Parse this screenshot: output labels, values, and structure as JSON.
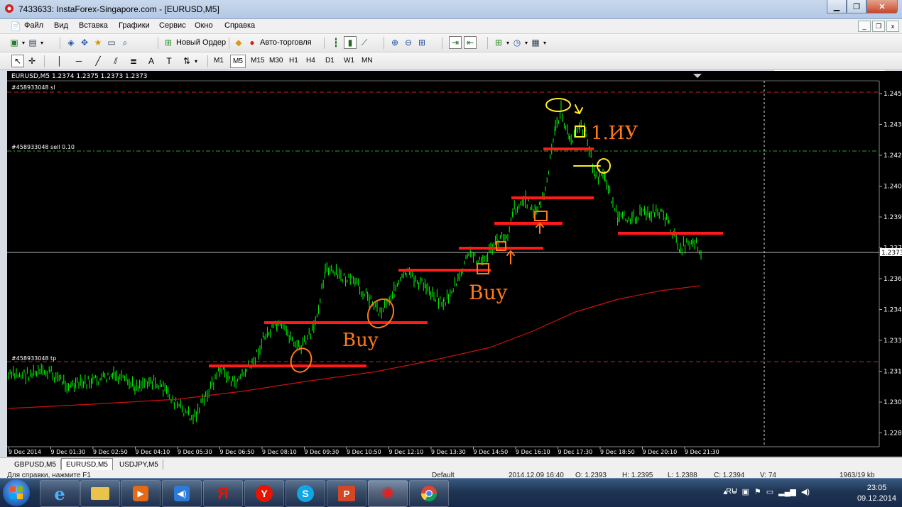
{
  "window": {
    "title": "7433633: InstaForex-Singapore.com - [EURUSD,M5]"
  },
  "menu": [
    "Файл",
    "Вид",
    "Вставка",
    "Графики",
    "Сервис",
    "Окно",
    "Справка"
  ],
  "toolbar": {
    "new_order": "Новый Ордер",
    "auto_trading": "Авто-торговля"
  },
  "timeframes": [
    "M1",
    "M5",
    "M15",
    "M30",
    "H1",
    "H4",
    "D1",
    "W1",
    "MN"
  ],
  "active_timeframe": "M5",
  "chart": {
    "header": "EURUSD,M5  1.2374 1.2375 1.2373 1.2373",
    "sl_label": "#458933048 sl",
    "sell_label": "#458933048 sell 0.10",
    "tp_label": "#458933048 tp",
    "current_price": "1.2373",
    "price_ticks": [
      "1.2450",
      "1.2435",
      "1.2420",
      "1.2405",
      "1.2390",
      "1.2375",
      "1.2360",
      "1.2345",
      "1.2330",
      "1.2315",
      "1.2300",
      "1.2285"
    ],
    "time_ticks": [
      "9 Dec 2014",
      "9 Dec 01:30",
      "9 Dec 02:50",
      "9 Dec 04:10",
      "9 Dec 05:30",
      "9 Dec 06:50",
      "9 Dec 08:10",
      "9 Dec 09:30",
      "9 Dec 10:50",
      "9 Dec 12:10",
      "9 Dec 13:30",
      "9 Dec 14:50",
      "9 Dec 16:10",
      "9 Dec 17:30",
      "9 Dec 18:50",
      "9 Dec 20:10",
      "9 Dec 21:30"
    ],
    "annotations": [
      "Buy",
      "Buy",
      "1.ИУ"
    ],
    "colors": {
      "bars": "#00ff00",
      "ma": "#cc1111",
      "levels": "#ff1a1a",
      "orange": "#ff7a1a",
      "yellow": "#ffee22"
    }
  },
  "tabs": [
    "GBPUSD,M5",
    "EURUSD,M5",
    "USDJPY,M5"
  ],
  "active_tab": "EURUSD,M5",
  "status": {
    "help": "Для справки, нажмите F1",
    "profile": "Default",
    "datetime": "2014.12.09 16:40",
    "open": "O: 1.2393",
    "high": "H: 1.2395",
    "low": "L: 1.2388",
    "close": "C: 1.2394",
    "volume": "V: 74",
    "traffic": "1963/19 kb"
  },
  "taskbar": {
    "lang": "RU",
    "time": "23:05",
    "date": "09.12.2014",
    "apps": [
      "ie",
      "explorer",
      "media",
      "volume",
      "yandex",
      "yandex-browser",
      "skype",
      "powerpoint",
      "mt4",
      "chrome"
    ]
  }
}
